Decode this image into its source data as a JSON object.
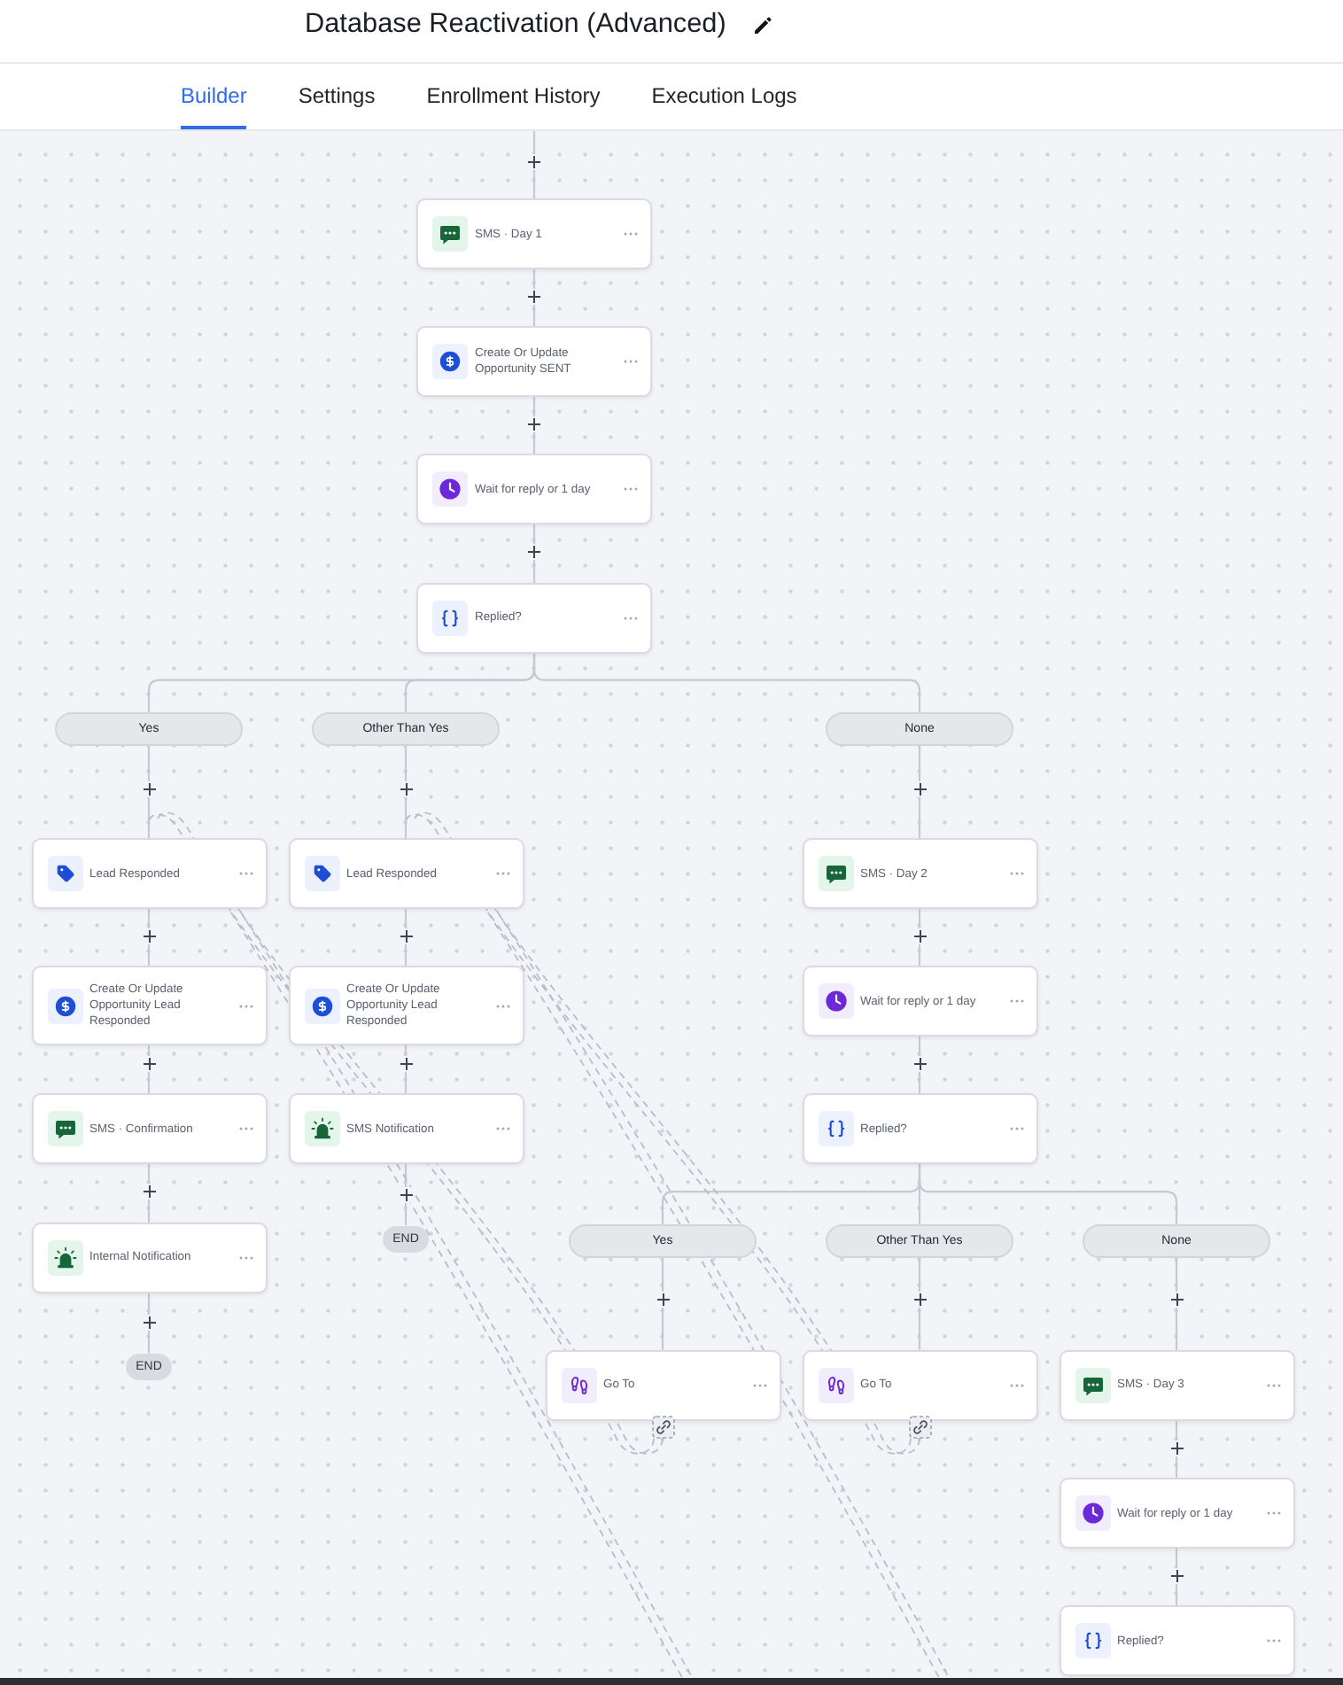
{
  "header": {
    "title": "Database Reactivation (Advanced)"
  },
  "tabs": [
    {
      "label": "Builder",
      "selected": true
    },
    {
      "label": "Settings",
      "selected": false
    },
    {
      "label": "Enrollment History",
      "selected": false
    },
    {
      "label": "Execution Logs",
      "selected": false
    }
  ],
  "workflow": {
    "steps": [
      {
        "kind": "sms",
        "title": "SMS · Day 1"
      },
      {
        "kind": "opportunity",
        "title": "Create Or Update Opportunity SENT"
      },
      {
        "kind": "wait",
        "title": "Wait for reply or 1 day"
      },
      {
        "kind": "condition",
        "title": "Replied?",
        "branches": [
          {
            "label": "Yes",
            "steps": [
              {
                "kind": "tag",
                "title": "Lead Responded"
              },
              {
                "kind": "opportunity",
                "title": "Create Or Update Opportunity Lead Responded"
              },
              {
                "kind": "sms",
                "title": "SMS · Confirmation"
              },
              {
                "kind": "notification",
                "title": "Internal Notification"
              }
            ],
            "end": "END"
          },
          {
            "label": "Other Than Yes",
            "steps": [
              {
                "kind": "tag",
                "title": "Lead Responded"
              },
              {
                "kind": "opportunity",
                "title": "Create Or Update Opportunity Lead Responded"
              },
              {
                "kind": "notification",
                "title": "SMS Notification"
              }
            ],
            "end": "END"
          },
          {
            "label": "None",
            "steps": [
              {
                "kind": "sms",
                "title": "SMS · Day 2"
              },
              {
                "kind": "wait",
                "title": "Wait for reply or 1 day"
              },
              {
                "kind": "condition",
                "title": "Replied?",
                "branches": [
                  {
                    "label": "Yes",
                    "steps": [
                      {
                        "kind": "goto",
                        "title": "Go To"
                      }
                    ]
                  },
                  {
                    "label": "Other Than Yes",
                    "steps": [
                      {
                        "kind": "goto",
                        "title": "Go To"
                      }
                    ]
                  },
                  {
                    "label": "None",
                    "steps": [
                      {
                        "kind": "sms",
                        "title": "SMS · Day 3"
                      },
                      {
                        "kind": "wait",
                        "title": "Wait for reply or 1 day"
                      },
                      {
                        "kind": "condition",
                        "title": "Replied?"
                      }
                    ]
                  }
                ]
              }
            ]
          }
        ]
      }
    ]
  }
}
